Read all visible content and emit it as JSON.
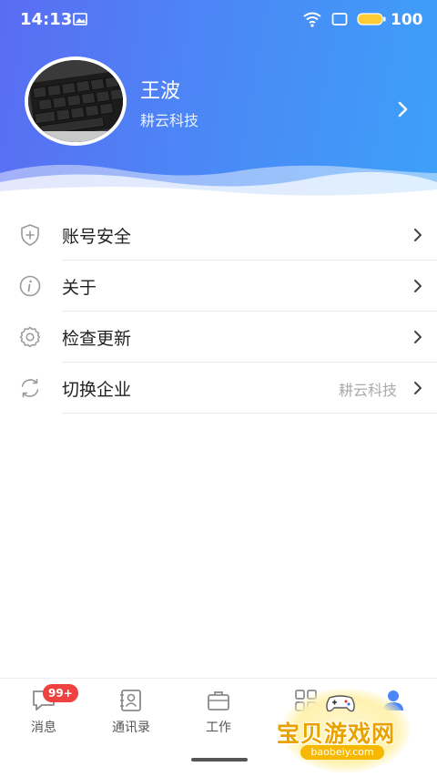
{
  "status_bar": {
    "time": "14:13",
    "battery": "100"
  },
  "profile": {
    "name": "王波",
    "company": "耕云科技"
  },
  "menu": [
    {
      "label": "账号安全",
      "value": "",
      "icon": "shield-icon"
    },
    {
      "label": "关于",
      "value": "",
      "icon": "info-icon"
    },
    {
      "label": "检查更新",
      "value": "",
      "icon": "gear-icon"
    },
    {
      "label": "切换企业",
      "value": "耕云科技",
      "icon": "switch-icon"
    }
  ],
  "tabs": [
    {
      "label": "消息",
      "badge": "99+",
      "icon": "message-icon"
    },
    {
      "label": "通讯录",
      "icon": "contacts-icon"
    },
    {
      "label": "工作",
      "icon": "briefcase-icon"
    },
    {
      "label": "",
      "icon": "apps-grid-icon"
    },
    {
      "label": "",
      "icon": "user-icon",
      "active": true
    }
  ],
  "watermark": {
    "text": "宝贝游戏网",
    "url": "baobeiy.com"
  },
  "colors": {
    "accent": "#4c86f6",
    "badge": "#f04141",
    "watermark": "#e8a300"
  }
}
